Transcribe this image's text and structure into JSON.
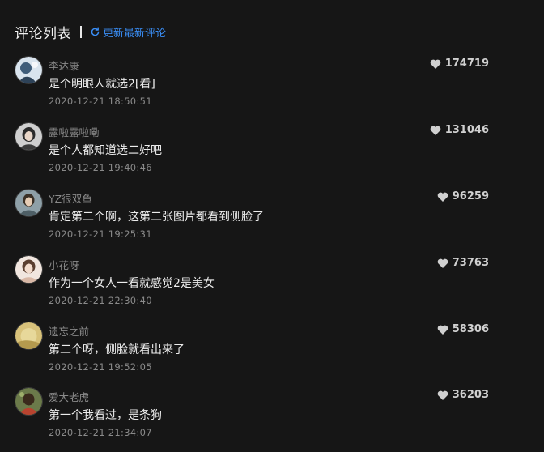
{
  "header": {
    "title": "评论列表",
    "refresh_label": "更新最新评论"
  },
  "comments": [
    {
      "username": "李达康",
      "text": "是个明眼人就选2[看]",
      "time": "2020-12-21 18:50:51",
      "likes": "174719"
    },
    {
      "username": "露啦露啦嘞",
      "text": "是个人都知道选二好吧",
      "time": "2020-12-21 19:40:46",
      "likes": "131046"
    },
    {
      "username": "YZ很双鱼",
      "text": "肯定第二个啊，这第二张图片都看到侧脸了",
      "time": "2020-12-21 19:25:31",
      "likes": "96259"
    },
    {
      "username": "小花呀",
      "text": "作为一个女人一看就感觉2是美女",
      "time": "2020-12-21 22:30:40",
      "likes": "73763"
    },
    {
      "username": "遗忘之前",
      "text": "第二个呀，侧脸就看出来了",
      "time": "2020-12-21 19:52:05",
      "likes": "58306"
    },
    {
      "username": "爱大老虎",
      "text": "第一个我看过，是条狗",
      "time": "2020-12-21 21:34:07",
      "likes": "36203"
    }
  ],
  "colors": {
    "background": "#161616",
    "accent": "#3a8ef6",
    "muted": "#8a8a8a"
  }
}
